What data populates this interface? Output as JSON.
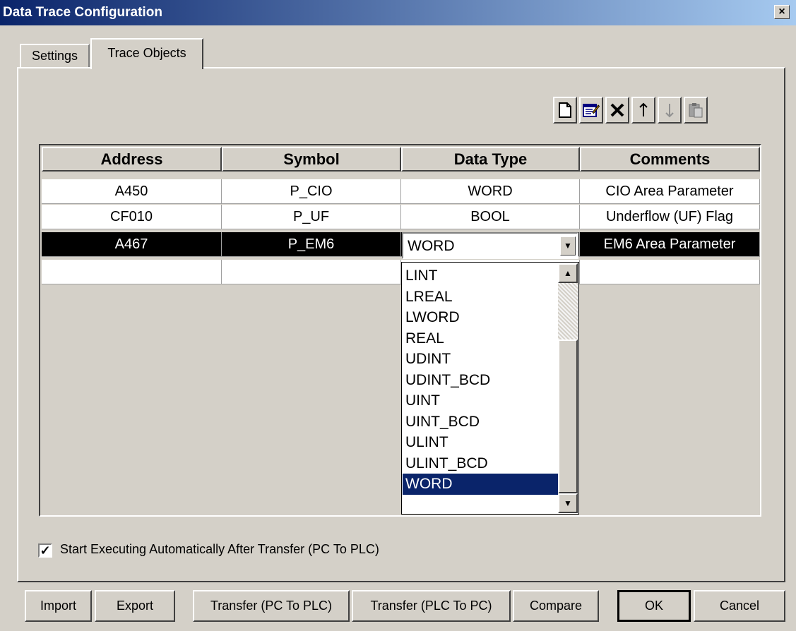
{
  "window": {
    "title": "Data Trace Configuration",
    "close_label": "×"
  },
  "tabs": [
    {
      "label": "Settings"
    },
    {
      "label": "Trace Objects"
    }
  ],
  "toolbar": {
    "buttons": [
      "new-icon",
      "edit-icon",
      "delete-icon",
      "move-up-icon",
      "move-down-icon",
      "paste-icon"
    ]
  },
  "grid": {
    "columns": [
      "Address",
      "Symbol",
      "Data Type",
      "Comments"
    ],
    "rows": [
      {
        "address": "A450",
        "symbol": "P_CIO",
        "data_type": "WORD",
        "comments": "CIO Area Parameter"
      },
      {
        "address": "CF010",
        "symbol": "P_UF",
        "data_type": "BOOL",
        "comments": "Underflow (UF) Flag"
      },
      {
        "address": "A467",
        "symbol": "P_EM6",
        "data_type": "WORD",
        "comments": "EM6 Area Parameter"
      },
      {
        "address": "",
        "symbol": "",
        "data_type": "",
        "comments": ""
      }
    ]
  },
  "data_type_dropdown": {
    "value": "WORD",
    "options": [
      "LINT",
      "LREAL",
      "LWORD",
      "REAL",
      "UDINT",
      "UDINT_BCD",
      "UINT",
      "UINT_BCD",
      "ULINT",
      "ULINT_BCD",
      "WORD"
    ],
    "highlighted": "WORD"
  },
  "auto_start": {
    "checked": true,
    "label": "Start Executing Automatically After Transfer (PC To PLC)"
  },
  "buttons": {
    "import": "Import",
    "export": "Export",
    "transfer_pc_to_plc": "Transfer (PC To PLC)",
    "transfer_plc_to_pc": "Transfer (PLC To PC)",
    "compare": "Compare",
    "ok": "OK",
    "cancel": "Cancel"
  }
}
